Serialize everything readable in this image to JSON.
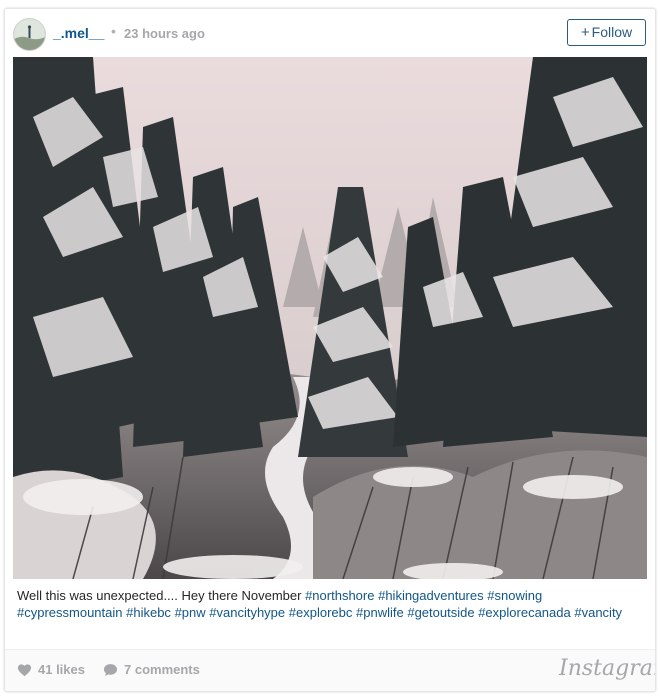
{
  "post": {
    "user": {
      "username": "_.mel__",
      "avatar": "avatar"
    },
    "separator": "•",
    "time_ago": "23 hours ago",
    "follow_label": "Follow",
    "follow_icon": "plus-icon",
    "photo": {
      "subject": "snow-covered evergreen forest",
      "colors": {
        "sky": "#e6d6d8",
        "snow": "#f2eeee",
        "trees": "#2f3536"
      }
    },
    "caption": {
      "text": "Well this was unexpected.... Hey there November",
      "hashtags": [
        "#northshore",
        "#hikingadventures",
        "#snowing",
        "#cypressmountain",
        "#hikebc",
        "#pnw",
        "#vancityhype",
        "#explorebc",
        "#pnwlife",
        "#getoutside",
        "#explorecanada",
        "#vancity"
      ]
    },
    "likes": {
      "icon": "heart-icon",
      "label": "41 likes"
    },
    "comments": {
      "icon": "comment-icon",
      "label": "7 comments"
    },
    "brand": "Instagram"
  },
  "colors": {
    "link": "#125688",
    "muted": "#a5a7aa",
    "text": "#262626",
    "follow_border": "#2a5b83"
  }
}
